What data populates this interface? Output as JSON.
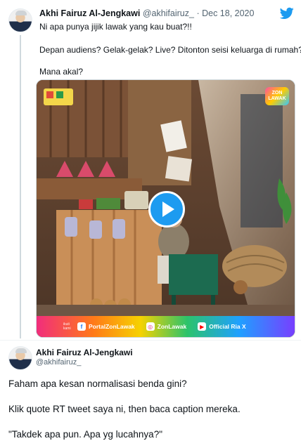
{
  "quoted_tweet": {
    "display_name": "Akhi Fairuz Al-Jengkawi",
    "handle": "@akhifairuz_",
    "separator": "·",
    "date": "Dec 18, 2020",
    "lines": [
      "Ni apa punya jijik lawak yang kau buat?!!",
      "Depan audiens? Gelak-gelak? Live? Ditonton seisi keluarga di rumah?",
      "Mana akal?"
    ],
    "video": {
      "badge": "ZON LAWAK",
      "banner_label": "ikuti kami",
      "socials": [
        {
          "icon": "facebook-icon",
          "label": "PortalZonLawak"
        },
        {
          "icon": "instagram-icon",
          "label": "ZonLawak"
        },
        {
          "icon": "youtube-icon",
          "label": "Official Ria X"
        }
      ]
    }
  },
  "main_tweet": {
    "display_name": "Akhi Fairuz Al-Jengkawi",
    "handle": "@akhifairuz_",
    "lines": [
      "Faham apa kesan normalisasi benda gini?",
      "Klik quote RT tweet saya ni, then baca caption mereka.",
      "\"Takdek apa pun. Apa yg lucahnya?\""
    ]
  },
  "colors": {
    "twitter_blue": "#1d9bf0",
    "text": "#0f1419",
    "secondary_text": "#536471",
    "border": "#cfd9de"
  }
}
